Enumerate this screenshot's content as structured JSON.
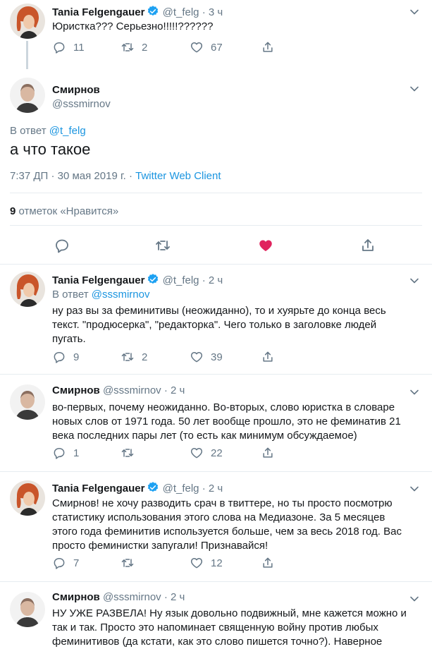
{
  "colors": {
    "accent": "#1b95e0",
    "like": "#e0245e",
    "muted": "#657786",
    "divider": "#e6ecf0"
  },
  "tweet1": {
    "name": "Tania Felgengauer",
    "handle": "@t_felg",
    "time": "· 3 ч",
    "text": "Юристка??? Серьезно!!!!!??????",
    "replies": "11",
    "retweets": "2",
    "likes": "67"
  },
  "main": {
    "name": "Смирнов",
    "handle": "@sssmirnov",
    "reply_prefix": "В ответ",
    "reply_to": "@t_felg",
    "text": "а что такое",
    "timestamp": "7:37 ДП · 30 мая 2019 г. · ",
    "source": "Twitter Web Client",
    "likes_count": "9",
    "likes_label": " отметок «Нравится»"
  },
  "reply1": {
    "name": "Tania Felgengauer",
    "handle": "@t_felg",
    "time": "· 2 ч",
    "reply_prefix": "В ответ",
    "reply_to": "@sssmirnov",
    "lines": [
      "ну раз вы за феминитивы (неожиданно), то и хуярьте до конца весь",
      "текст. \"продюсерка\", \"редакторка\". Чего  только в заголовке людей",
      "пугать."
    ],
    "replies": "9",
    "retweets": "2",
    "likes": "39"
  },
  "reply2": {
    "name": "Смирнов",
    "handle": "@sssmirnov",
    "time": "· 2 ч",
    "lines": [
      "во-первых, почему неожиданно. Во-вторых, слово юристка в словаре",
      "новых слов от 1971 года. 50 лет вообще прошло, это не феминатив 21",
      "века последних пары лет (то есть как минимум обсуждаемое)"
    ],
    "replies": "1",
    "retweets": "",
    "likes": "22"
  },
  "reply3": {
    "name": "Tania Felgengauer",
    "handle": "@t_felg",
    "time": "· 2 ч",
    "lines": [
      "Смирнов! не хочу разводить срач в твиттере, но ты просто посмотрю",
      "статистику использования этого слова на Медиазоне. За 5 месяцев",
      "этого года феминитив используется больше, чем за весь 2018 год. Вас",
      "просто феминистки запугали! Признавайся!"
    ],
    "replies": "7",
    "retweets": "",
    "likes": "12"
  },
  "reply4": {
    "name": "Смирнов",
    "handle": "@sssmirnov",
    "time": "· 2 ч",
    "lines": [
      "НУ УЖЕ РАЗВЕЛА! Ну язык довольно подвижный, мне кажется можно и",
      "так и так. Просто это напоминает священную войну против любых",
      "феминитивов (да кстати, как это слово пишется точно?). Наверное"
    ]
  }
}
